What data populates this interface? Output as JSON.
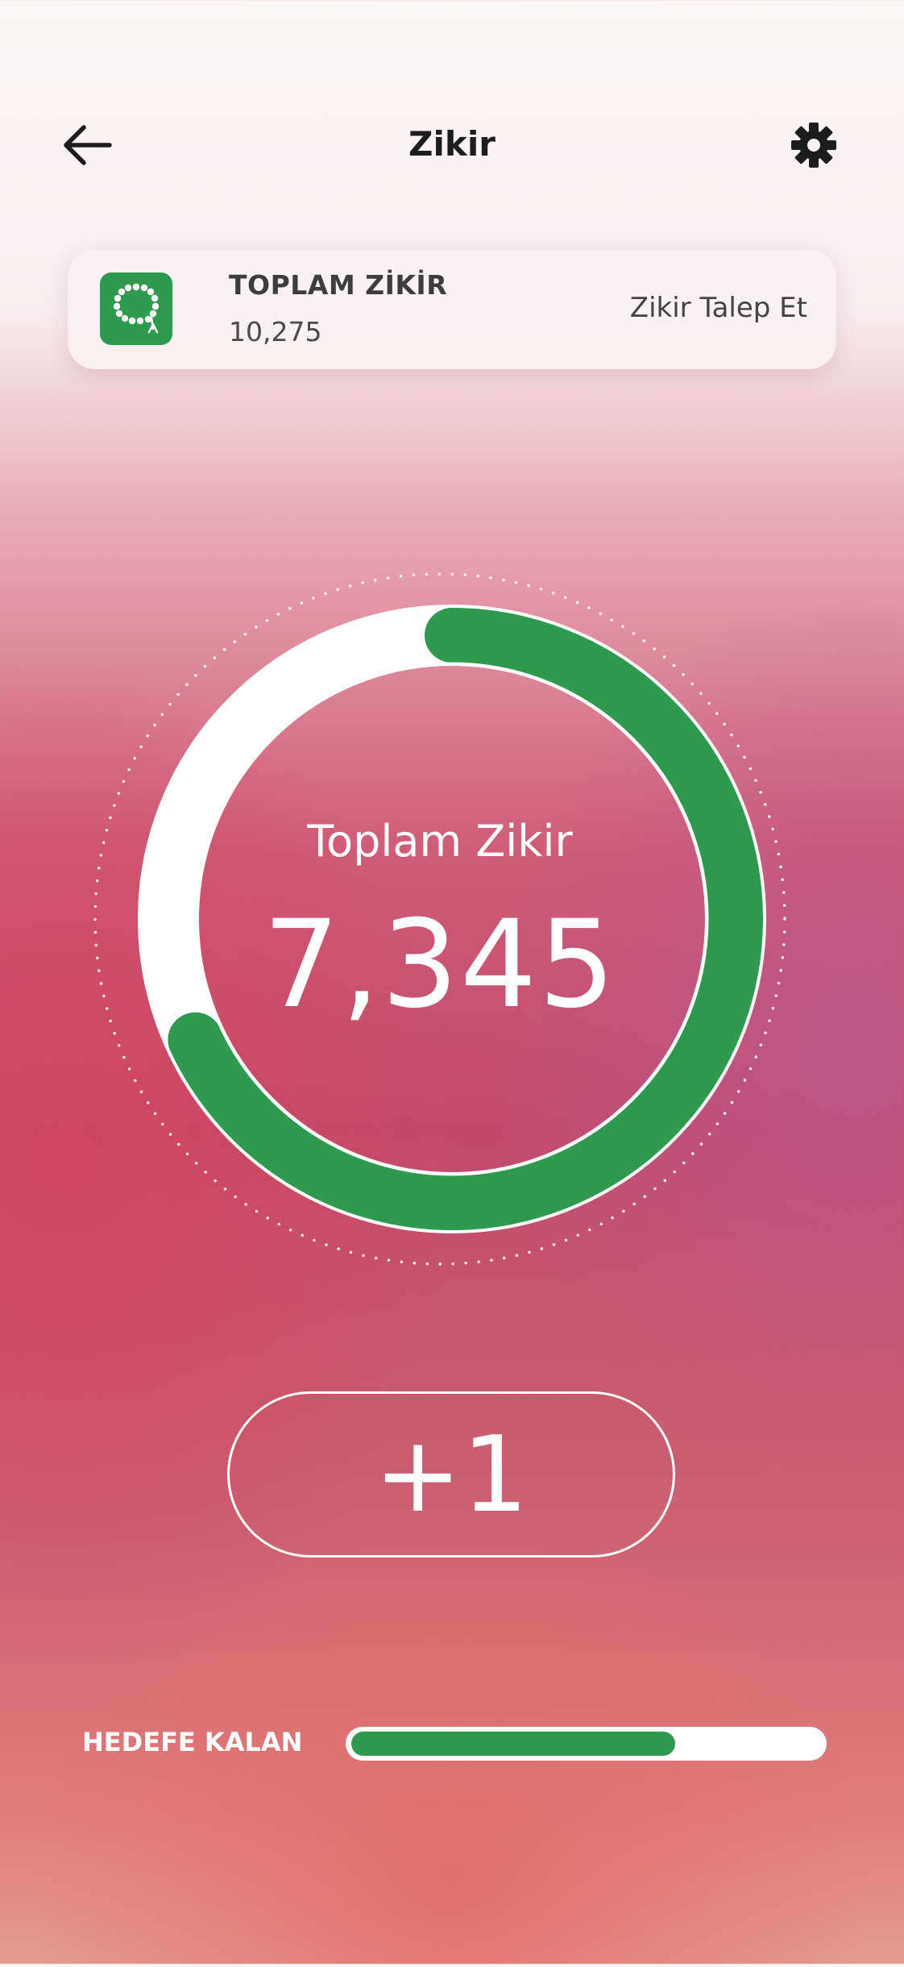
{
  "header": {
    "back_icon": "arrow-left-icon",
    "title": "Zikir",
    "settings_icon": "gear-icon"
  },
  "summary_card": {
    "icon": "prayer-beads-icon",
    "title": "TOPLAM ZİKİR",
    "value": "10,275",
    "request_label": "Zikir Talep Et"
  },
  "counter": {
    "label": "Toplam Zikir",
    "count": "7,345",
    "ring_progress_fraction": 0.68
  },
  "increment_button": {
    "label": "+1"
  },
  "goal": {
    "label": "HEDEFE KALAN",
    "progress_fraction": 0.69
  },
  "colors": {
    "accent_green": "#2f9a4e",
    "text_dark": "#1d1d1d",
    "white": "#ffffff"
  }
}
